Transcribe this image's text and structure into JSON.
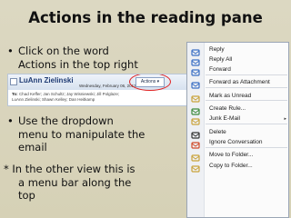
{
  "title": "Actions in the reading pane",
  "bullets": [
    {
      "marker": "•",
      "text": "Click on the word\nActions in the top right"
    },
    {
      "marker": "•",
      "text": "Use the dropdown\nmenu to manipulate the\nemail"
    },
    {
      "marker": "*",
      "text": "* In the other view this is\na menu bar along the\ntop"
    }
  ],
  "email_header": {
    "sender": "LuAnn Zielinski",
    "date": "Wednesday, February 06, 2013 2:37 PM",
    "actions_label": "Actions ▾",
    "to_label": "To:",
    "recipients": "Chad Keffer; Jan Schultz; Jay Wisniewski; Jill Polglaze;",
    "recipients2": "LuAnn Zielinski; Shawn Kelley; Dan Heitkamp"
  },
  "menu": {
    "items": [
      {
        "label": "Reply",
        "icon": "reply-icon",
        "color": "#3b6fc4"
      },
      {
        "label": "Reply All",
        "icon": "reply-all-icon",
        "color": "#3b6fc4"
      },
      {
        "label": "Forward",
        "icon": "forward-icon",
        "color": "#3b6fc4"
      },
      {
        "label": "Forward as Attachment",
        "icon": "forward-attachment-icon",
        "color": "#3b6fc4"
      },
      {
        "label": "Mark as Unread",
        "icon": "envelope-icon",
        "color": "#c9a23a"
      },
      {
        "label": "Create Rule...",
        "icon": "rule-icon",
        "color": "#3b8a3b"
      },
      {
        "label": "Junk E-Mail",
        "icon": "junk-icon",
        "color": "#c9a23a",
        "submenu": "▸"
      },
      {
        "label": "Delete",
        "icon": "delete-icon",
        "color": "#333333"
      },
      {
        "label": "Ignore Conversation",
        "icon": "ignore-icon",
        "color": "#d04a2a"
      },
      {
        "label": "Move to Folder...",
        "icon": "move-folder-icon",
        "color": "#c9a23a"
      },
      {
        "label": "Copy to Folder...",
        "icon": "copy-folder-icon",
        "color": "#c9a23a"
      }
    ]
  }
}
